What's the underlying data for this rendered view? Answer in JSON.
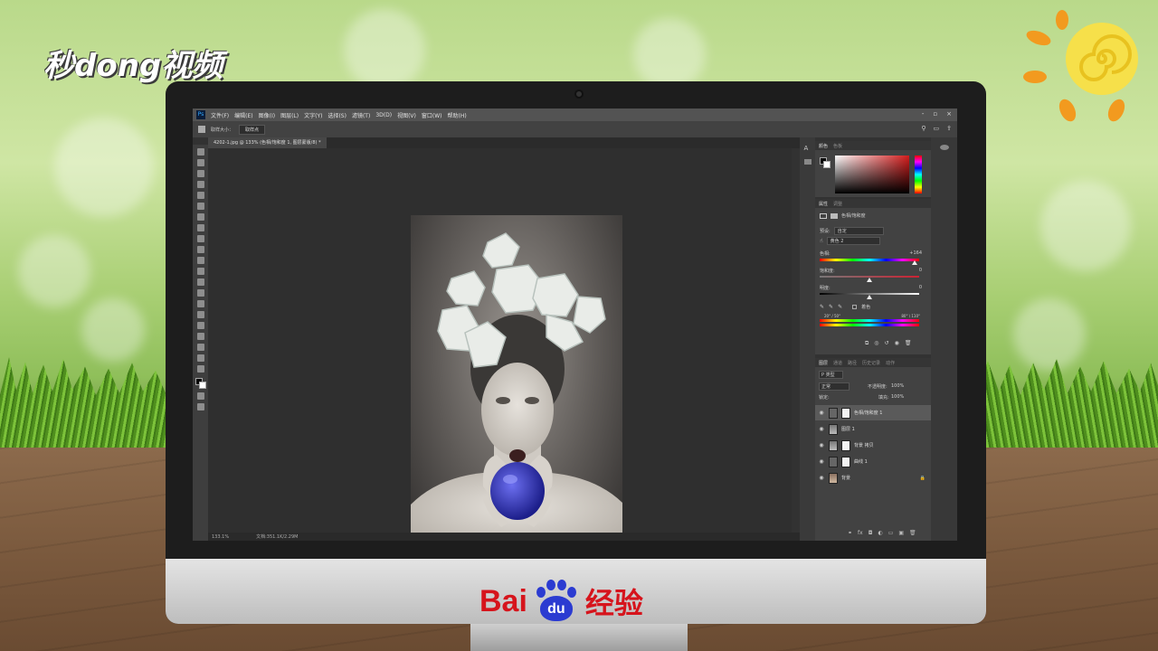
{
  "watermark": {
    "logo_text": "秒dong视频"
  },
  "brand": {
    "bai": "Bai",
    "du": "du",
    "jingyan": "经验"
  },
  "photoshop": {
    "app_icon": "Ps",
    "menu": [
      "文件(F)",
      "编辑(E)",
      "图像(I)",
      "图层(L)",
      "文字(Y)",
      "选择(S)",
      "滤镜(T)",
      "3D(D)",
      "视图(V)",
      "窗口(W)",
      "帮助(H)"
    ],
    "window_controls": [
      "-",
      "▫",
      "×"
    ],
    "options": {
      "sample_size_label": "取样大小：",
      "sample_size_value": "取样点"
    },
    "doc_tab": "4202-1.jpg @ 133% (色相/饱和度 1, 图层蒙版/8) *",
    "status": {
      "zoom": "133.1%",
      "doc_info": "文档:351.1K/2.29M"
    },
    "color_panel": {
      "tabs": [
        "颜色",
        "色板"
      ]
    },
    "properties_panel": {
      "tabs": [
        "属性",
        "调整"
      ],
      "title": "色相/饱和度",
      "preset_label": "预设:",
      "preset_value": "自定",
      "channel_value": "黄色 2",
      "hue_label": "色相:",
      "hue_value": "+164",
      "saturation_label": "饱和度:",
      "saturation_value": "0",
      "lightness_label": "明度:",
      "lightness_value": "0",
      "colorize_label": "着色",
      "range_left": "20° / 50°",
      "range_right": "80° \\ 110°"
    },
    "layers_panel": {
      "tabs": [
        "图层",
        "通道",
        "路径",
        "历史记录",
        "动作"
      ],
      "kind_filter": "P 类型",
      "blend_mode": "正常",
      "opacity_label": "不透明度:",
      "opacity_value": "100%",
      "lock_label": "锁定:",
      "fill_label": "填充:",
      "fill_value": "100%",
      "layers": [
        {
          "name": "色相/饱和度 1"
        },
        {
          "name": "图层 1"
        },
        {
          "name": "背景 拷贝"
        },
        {
          "name": "曲线 1"
        },
        {
          "name": "背景"
        }
      ]
    }
  }
}
